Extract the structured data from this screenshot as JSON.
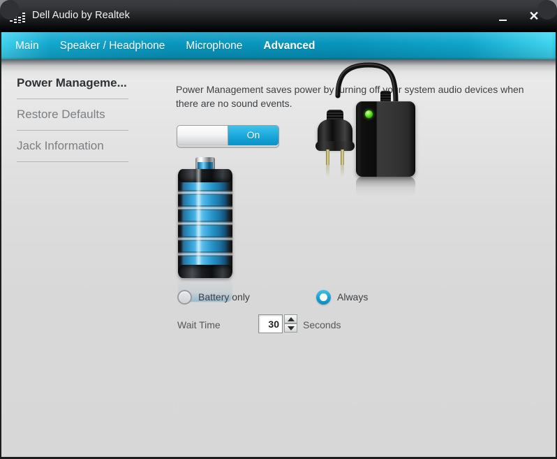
{
  "window": {
    "title": "Dell Audio by Realtek",
    "icon": "equalizer-icon",
    "minimize_label": "",
    "close_label": "✕"
  },
  "tabs": [
    {
      "label": "Main",
      "active": false
    },
    {
      "label": "Speaker / Headphone",
      "active": false
    },
    {
      "label": "Microphone",
      "active": false
    },
    {
      "label": "Advanced",
      "active": true
    }
  ],
  "sidebar": {
    "items": [
      {
        "label": "Power Manageme...",
        "active": true
      },
      {
        "label": "Restore Defaults",
        "active": false
      },
      {
        "label": "Jack Information",
        "active": false
      }
    ]
  },
  "main": {
    "description": "Power Management saves power by turning off your system audio devices when there are no sound events.",
    "toggle": {
      "state_label": "On",
      "on": true
    },
    "graphics": {
      "battery": "battery-icon",
      "adapter": "ac-adapter-icon",
      "adapter_led_color": "#5ae628"
    },
    "power_source_options": [
      {
        "label": "Battery only",
        "selected": false
      },
      {
        "label": "Always",
        "selected": true
      }
    ],
    "wait_time": {
      "label": "Wait Time",
      "value": "30",
      "unit": "Seconds"
    }
  },
  "colors": {
    "accent": "#0c9cc9",
    "accent_light": "#3ed5f0",
    "titlebar": "#1e2022",
    "body_bg": "#d8d8d8",
    "text_primary": "#3c3f42",
    "text_muted": "#7c7f82"
  }
}
